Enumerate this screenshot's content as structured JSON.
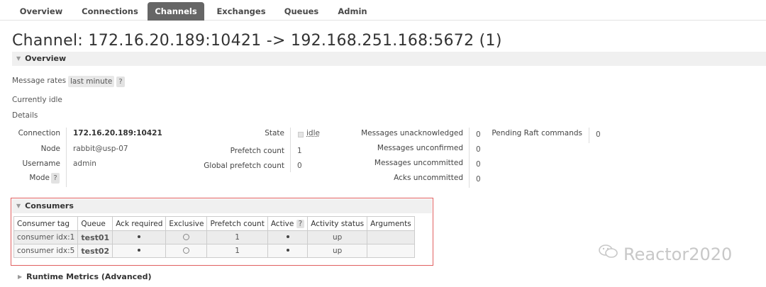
{
  "nav": {
    "tabs": [
      "Overview",
      "Connections",
      "Channels",
      "Exchanges",
      "Queues",
      "Admin"
    ],
    "active": "Channels"
  },
  "page_title": "Channel: 172.16.20.189:10421 -> 192.168.251.168:5672 (1)",
  "overview": {
    "header": "Overview",
    "message_rates_label": "Message rates",
    "message_rates_value": "last minute",
    "help": "?",
    "idle_text": "Currently idle",
    "details_label": "Details",
    "details": {
      "connection_label": "Connection",
      "connection_value": "172.16.20.189:10421",
      "node_label": "Node",
      "node_value": "rabbit@usp-07",
      "username_label": "Username",
      "username_value": "admin",
      "mode_label": "Mode",
      "state_label": "State",
      "state_value": "idle",
      "prefetch_label": "Prefetch count",
      "prefetch_value": "1",
      "global_prefetch_label": "Global prefetch count",
      "global_prefetch_value": "0",
      "unacked_label": "Messages unacknowledged",
      "unacked_value": "0",
      "unconfirmed_label": "Messages unconfirmed",
      "unconfirmed_value": "0",
      "uncommitted_label": "Messages uncommitted",
      "uncommitted_value": "0",
      "acks_uncommitted_label": "Acks uncommitted",
      "acks_uncommitted_value": "0",
      "raft_label": "Pending Raft commands",
      "raft_value": "0"
    }
  },
  "consumers": {
    "header": "Consumers",
    "columns": [
      "Consumer tag",
      "Queue",
      "Ack required",
      "Exclusive",
      "Prefetch count",
      "Active",
      "Activity status",
      "Arguments"
    ],
    "rows": [
      {
        "tag": "consumer idx:1",
        "queue": "test01",
        "ack_required": true,
        "exclusive": false,
        "prefetch": "1",
        "active": true,
        "status": "up",
        "arguments": ""
      },
      {
        "tag": "consumer idx:5",
        "queue": "test02",
        "ack_required": true,
        "exclusive": false,
        "prefetch": "1",
        "active": true,
        "status": "up",
        "arguments": ""
      }
    ]
  },
  "runtime_header": "Runtime Metrics (Advanced)",
  "watermark": "Reactor2020",
  "colors": {
    "highlight": "#e06060",
    "active_tab": "#666666"
  }
}
